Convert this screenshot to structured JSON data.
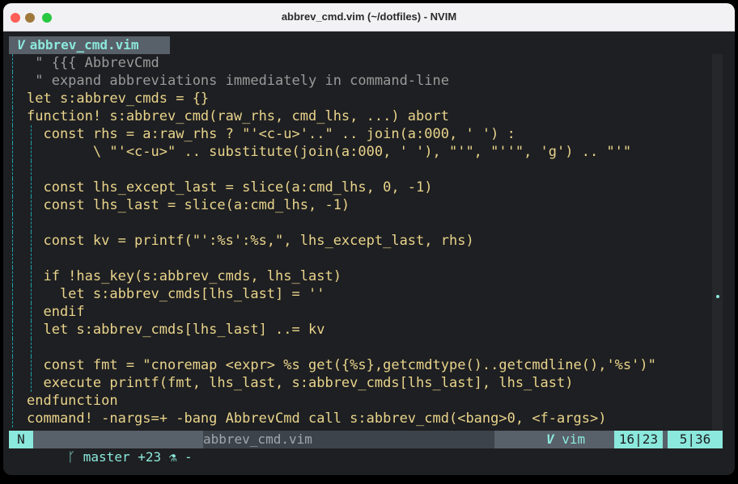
{
  "window": {
    "title": "abbrev_cmd.vim (~/dotfiles) - NVIM"
  },
  "tabline": {
    "icon": "vim-icon",
    "label": "abbrev_cmd.vim"
  },
  "lines": [
    " \" {{{ AbbrevCmd",
    " \" expand abbreviations immediately in command-line",
    "let s:abbrev_cmds = {}",
    "function! s:abbrev_cmd(raw_rhs, cmd_lhs, ...) abort",
    "  const rhs = a:raw_rhs ? \"'<c-u>'..\" .. join(a:000, ' ') :",
    "        \\ \"'<c-u>\" .. substitute(join(a:000, ' '), \"'\", \"''\", 'g') .. \"'\"",
    "",
    "  const lhs_except_last = slice(a:cmd_lhs, 0, -1)",
    "  const lhs_last = slice(a:cmd_lhs, -1)",
    "",
    "  const kv = printf(\"':%s':%s,\", lhs_except_last, rhs)",
    "",
    "  if !has_key(s:abbrev_cmds, lhs_last)",
    "    let s:abbrev_cmds[lhs_last] = ''",
    "  endif",
    "  let s:abbrev_cmds[lhs_last] ..= kv",
    "",
    "  const fmt = \"cnoremap <expr> %s get({%s},getcmdtype()..getcmdline(),'%s')\"",
    "  execute printf(fmt, lhs_last, s:abbrev_cmds[lhs_last], lhs_last)",
    "endfunction",
    "command! -nargs=+ -bang AbbrevCmd call s:abbrev_cmd(<bang>0, <f-args>)"
  ],
  "statusline": {
    "mode": "N",
    "branch_icon": "git-branch-icon",
    "branch": "master +23",
    "flask_icon": "flask-icon",
    "dash": "-",
    "filename": "abbrev_cmd.vim",
    "filetype_icon": "vim-icon",
    "filetype": "vim",
    "line_col": "16|23",
    "pos": "5|36"
  },
  "colors": {
    "accent": "#8be8dc",
    "status_bg": "#586069",
    "editor_bg": "#1e1f22"
  }
}
